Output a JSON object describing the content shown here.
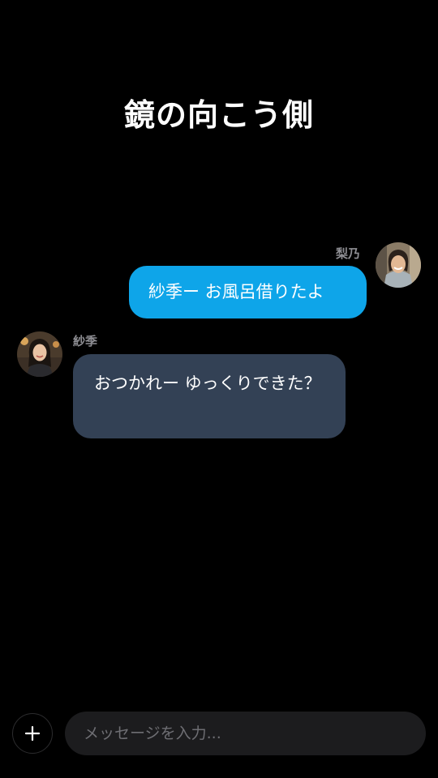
{
  "header": {
    "title": "鏡の向こう側"
  },
  "messages": [
    {
      "sender": "梨乃",
      "direction": "outgoing",
      "text": "紗季ー お風呂借りたよ",
      "avatar": "avatar-rino",
      "bubble_color": "#0ea5e9"
    },
    {
      "sender": "紗季",
      "direction": "incoming",
      "text": "おつかれー ゆっくりできた？",
      "avatar": "avatar-saki",
      "bubble_color": "#334155"
    }
  ],
  "composer": {
    "add_icon": "plus-icon",
    "placeholder": "メッセージを入力..."
  },
  "colors": {
    "background": "#000000",
    "outgoing_bubble": "#0ea5e9",
    "incoming_bubble": "#334155",
    "input_background": "#1c1c1e",
    "sender_name": "#8e8e93"
  }
}
